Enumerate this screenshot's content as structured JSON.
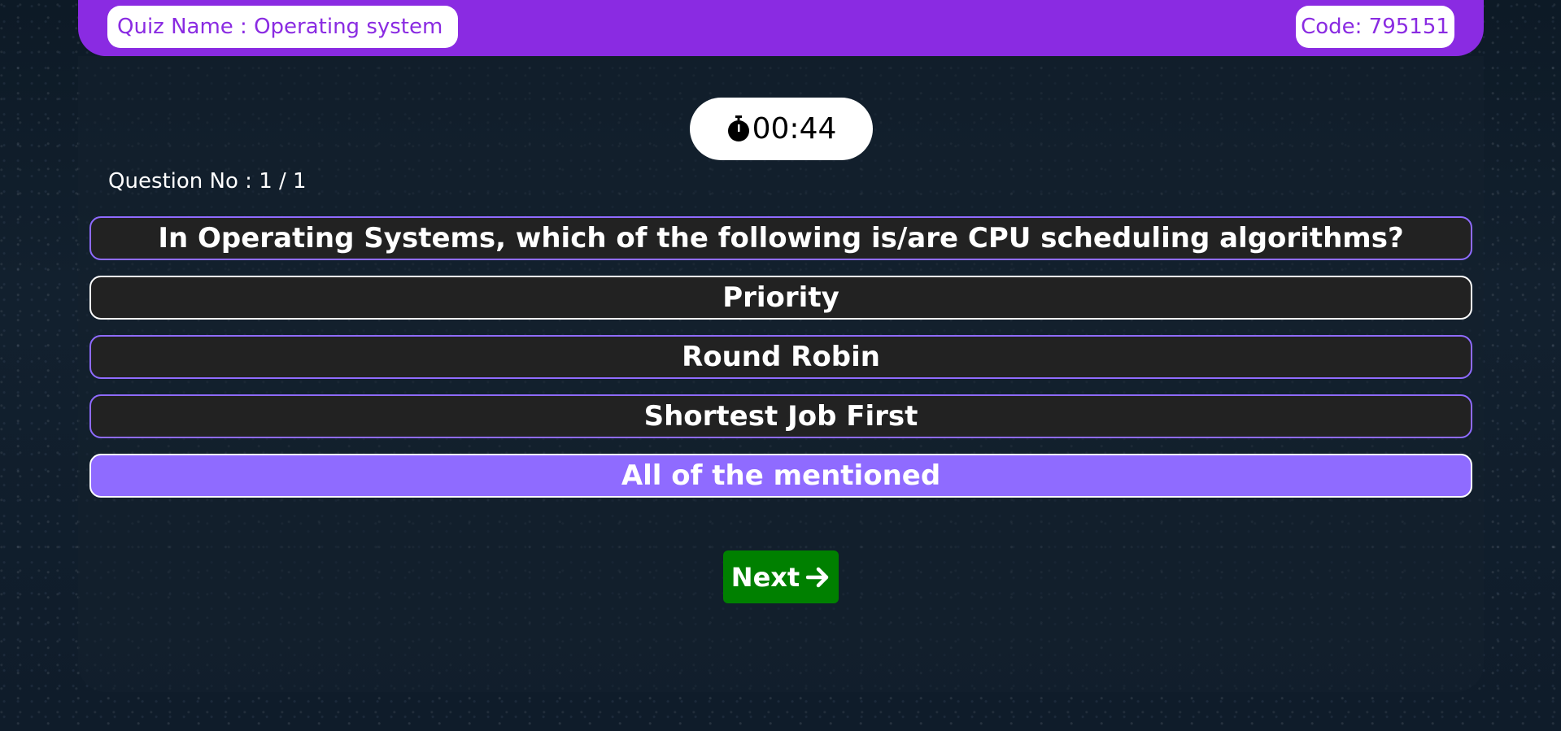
{
  "header": {
    "quiz_name": "Quiz Name : Operating system",
    "code": "Code: 795151",
    "background_color": "#8a2be2"
  },
  "timer": {
    "icon": "stopwatch-icon",
    "value": "00:44"
  },
  "question_number": "Question No : 1 / 1",
  "question": "In Operating Systems, which of the following is/are CPU scheduling algorithms?",
  "options": [
    {
      "label": "Priority",
      "selected": false
    },
    {
      "label": "Round Robin",
      "selected": false
    },
    {
      "label": "Shortest Job First",
      "selected": false
    },
    {
      "label": "All of the mentioned",
      "selected": true
    }
  ],
  "next_button": {
    "label": "Next",
    "icon": "arrow-right-icon",
    "color": "#008000"
  },
  "colors": {
    "option_border": "#8f6bff",
    "selected_option": "#8f6bff",
    "option_background": "#222222"
  }
}
